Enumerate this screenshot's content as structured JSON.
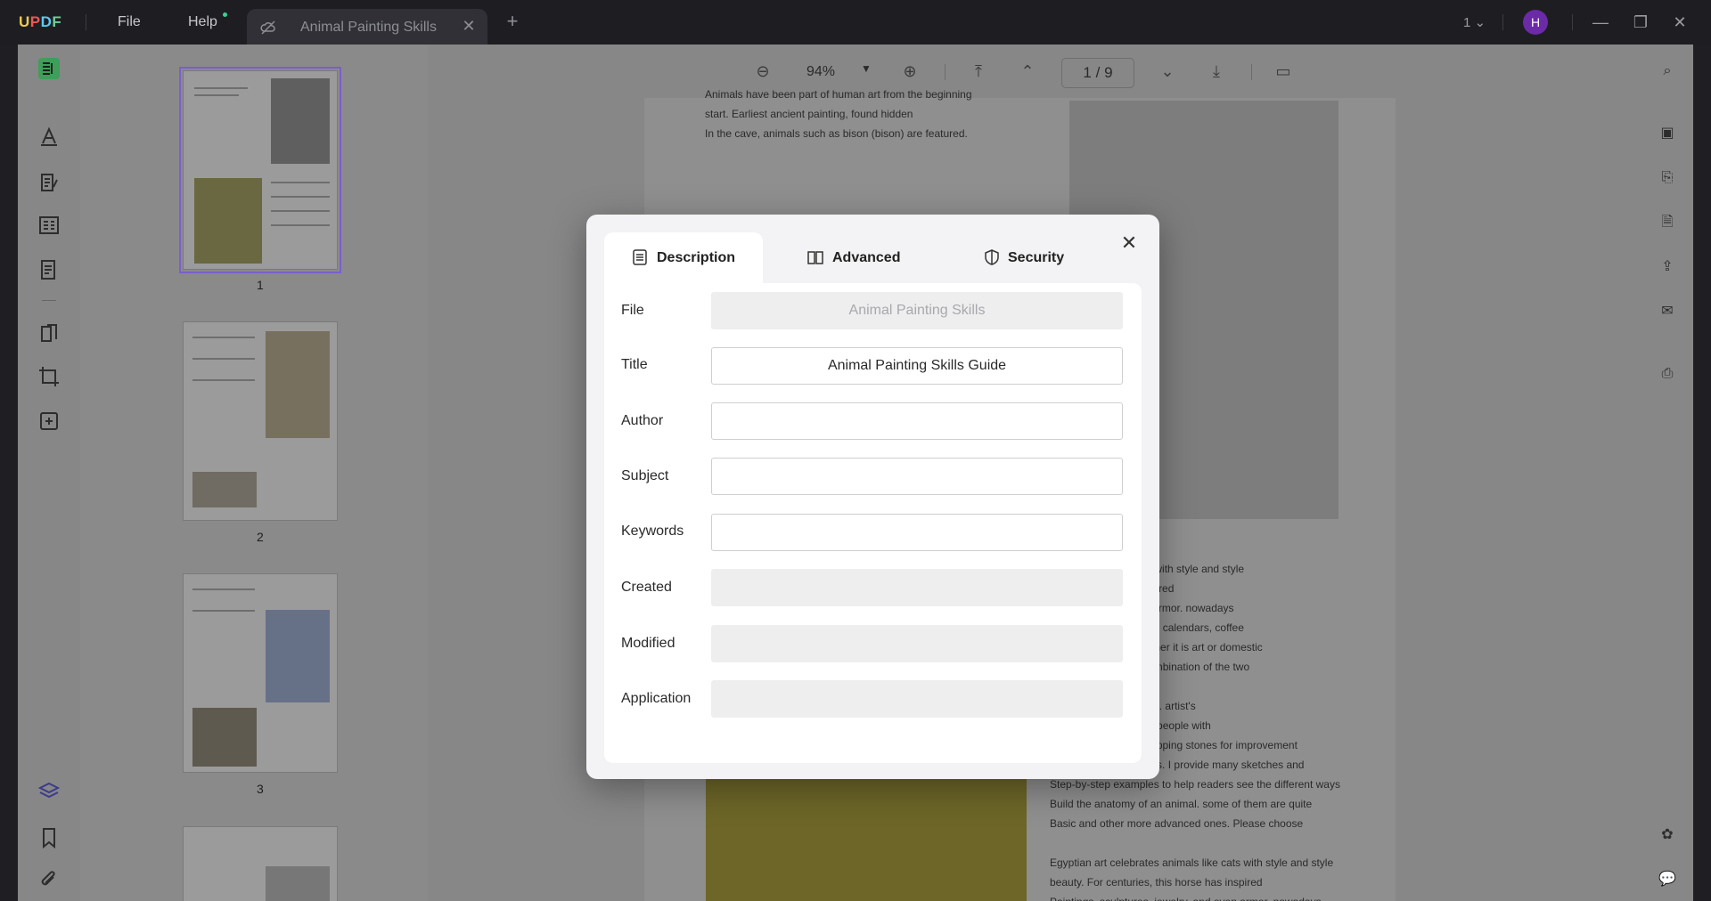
{
  "app": {
    "logo": "UPDF",
    "menu": {
      "file": "File",
      "help": "Help"
    },
    "tab_title": "Animal Painting Skills",
    "page_selector": "1",
    "avatar_initial": "H",
    "tab_close": "✕",
    "new_tab": "+"
  },
  "toolbar": {
    "zoom": "94%",
    "page_current": "1",
    "page_separator": "/",
    "page_total": "9"
  },
  "thumbnails": [
    {
      "number": "1"
    },
    {
      "number": "2"
    },
    {
      "number": "3"
    }
  ],
  "document": {
    "top_lines": [
      "Animals have been part of human art from the beginning",
      "start. Earliest ancient painting, found hidden",
      "In the cave, animals such as bison (bison) are featured."
    ],
    "right_lines": [
      "ates animals like cats with style and style",
      "es, this horse has inspired",
      "es, jewelry, and even armor. nowadays",
      "art sells a lot of t-shirts, calendars, coffee",
      "and other items. Whether it is art or domestic",
      "of our daily life, the combination of the two",
      "r.",
      "the subject of this book. artist's",
      "Guide aims to provide people with",
      "Various skill levels, stepping stones for improvement",
      "Their animal renderings. I provide many sketches and",
      "Step-by-step examples to help readers see the different ways",
      "Build the anatomy of an animal. some of them are quite",
      "Basic and other more advanced ones. Please choose",
      "",
      "Egyptian art celebrates animals like cats with style and style",
      "beauty. For centuries, this horse has inspired",
      "Paintings, sculptures, jewelry, and even armor. nowadays"
    ]
  },
  "dialog": {
    "tabs": {
      "description": "Description",
      "advanced": "Advanced",
      "security": "Security"
    },
    "close": "✕",
    "fields": {
      "file": {
        "label": "File",
        "value": "Animal Painting Skills"
      },
      "title": {
        "label": "Title",
        "value": "Animal Painting Skills Guide"
      },
      "author": {
        "label": "Author",
        "value": ""
      },
      "subject": {
        "label": "Subject",
        "value": ""
      },
      "keywords": {
        "label": "Keywords",
        "value": ""
      },
      "created": {
        "label": "Created",
        "value": ""
      },
      "modified": {
        "label": "Modified",
        "value": ""
      },
      "application": {
        "label": "Application",
        "value": ""
      }
    }
  }
}
